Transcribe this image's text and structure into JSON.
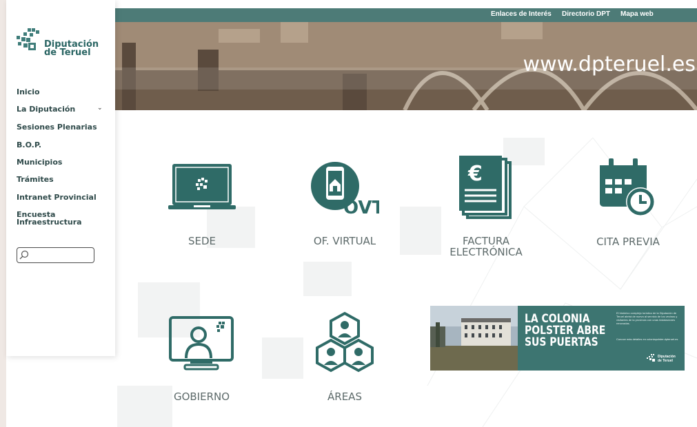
{
  "logo": {
    "line1": "Diputación",
    "line2": "de Teruel"
  },
  "nav": {
    "items": [
      {
        "label": "Inicio"
      },
      {
        "label": "La Diputación",
        "chevron": "chevron-down-icon"
      },
      {
        "label": "Sesiones Plenarias"
      },
      {
        "label": "B.O.P."
      },
      {
        "label": "Municipios"
      },
      {
        "label": "Trámites"
      },
      {
        "label": "Intranet Provincial"
      },
      {
        "label": "Encuesta Infraestructura",
        "line1": "Encuesta",
        "line2": "Infraestructura"
      }
    ]
  },
  "search": {
    "placeholder": "",
    "icon": "search-icon"
  },
  "topbar": {
    "links": [
      "Enlaces de Interés",
      "Directorio DPT",
      "Mapa web"
    ]
  },
  "hero": {
    "url": "www.dpteruel.es"
  },
  "tiles": [
    {
      "label": "SEDE",
      "icon": "laptop-icon"
    },
    {
      "label": "OF. VIRTUAL",
      "icon": "phone-ovt-icon",
      "badge": "OVT"
    },
    {
      "label_line1": "FACTURA",
      "label_line2": "ELECTRÓNICA",
      "icon": "invoice-euro-icon",
      "currency": "€"
    },
    {
      "label": "CITA PREVIA",
      "icon": "calendar-clock-icon"
    },
    {
      "label": "GOBIERNO",
      "icon": "monitor-person-icon"
    },
    {
      "label": "ÁREAS",
      "icon": "people-hexagon-icon"
    }
  ],
  "banner": {
    "headline_line1": "LA COLONIA",
    "headline_line2": "POLSTER ABRE",
    "headline_line3": "SUS PUERTAS",
    "small_text": "El histórico complejo turístico de la Diputación de Teruel abrirá de nuevo al servicio de los vecinos y visitantes de la provincia con unas instalaciones renovadas.",
    "small_text2": "Conoce más detalles en coloniapolster.dpteruel.es",
    "logo_line1": "Diputación",
    "logo_line2": "de Teruel"
  },
  "colors": {
    "brand": "#2b6664",
    "topbar": "#4d7b77",
    "nav_text": "#2f4a4a",
    "tile_label": "#5d6a6a"
  }
}
